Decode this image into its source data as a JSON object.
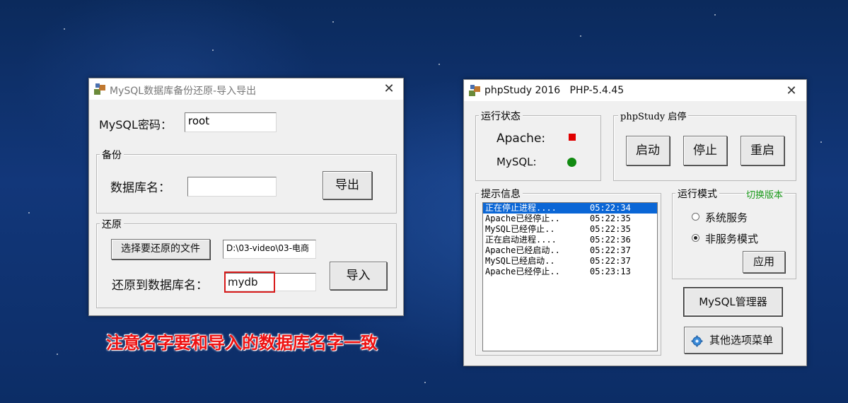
{
  "backup_window": {
    "title": "MySQL数据库备份还原-导入导出",
    "password_label": "MySQL密码：",
    "password_value": "root",
    "backup_group": {
      "title": "备份",
      "db_label": "数据库名：",
      "db_value": "",
      "export_button": "导出"
    },
    "restore_group": {
      "title": "还原",
      "choose_file_button": "选择要还原的文件",
      "file_path": "D:\\03-video\\03-电商",
      "target_db_label": "还原到数据库名：",
      "target_db_value": "mydb",
      "import_button": "导入"
    }
  },
  "annotation": "注意名字要和导入的数据库名字一致",
  "phpstudy_window": {
    "title": "phpStudy 2016   PHP-5.4.45",
    "status_group": {
      "title": "运行状态",
      "apache_label": "Apache:",
      "mysql_label": "MySQL:",
      "apache_color": "#e00000",
      "mysql_color": "#118a11"
    },
    "control_group": {
      "title": "phpStudy 启停",
      "start": "启动",
      "stop": "停止",
      "restart": "重启"
    },
    "log_group": {
      "title": "提示信息",
      "entries": [
        {
          "msg": "正在停止进程....",
          "time": "05:22:34"
        },
        {
          "msg": "Apache已经停止..",
          "time": "05:22:35"
        },
        {
          "msg": "MySQL已经停止..",
          "time": "05:22:35"
        },
        {
          "msg": "正在启动进程....",
          "time": "05:22:36"
        },
        {
          "msg": "Apache已经启动..",
          "time": "05:22:37"
        },
        {
          "msg": "MySQL已经启动..",
          "time": "05:22:37"
        },
        {
          "msg": "Apache已经停止..",
          "time": "05:23:13"
        }
      ]
    },
    "mode_group": {
      "title": "运行模式",
      "switch_link": "切换版本",
      "option_service": "系统服务",
      "option_non_service": "非服务模式",
      "selected": "非服务模式",
      "apply": "应用"
    },
    "mysql_manager": "MySQL管理器",
    "other_menu": "其他选项菜单"
  }
}
